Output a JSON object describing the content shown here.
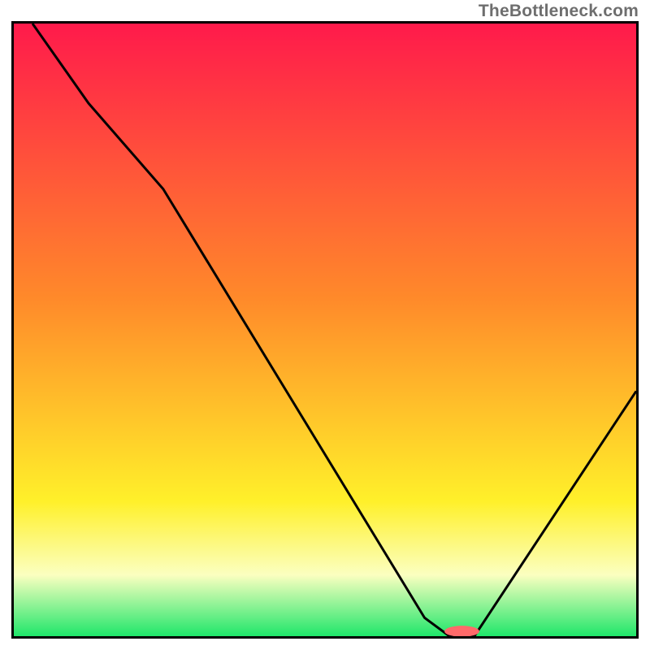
{
  "attribution": "TheBottleneck.com",
  "colors": {
    "red": "#ff1a4b",
    "orange": "#ff8a2a",
    "yellow": "#fff02a",
    "pale": "#fbffc0",
    "green": "#1fe66a",
    "marker": "#ff6a6a",
    "line": "#000000",
    "border": "#000000"
  },
  "chart_data": {
    "type": "line",
    "title": "",
    "xlabel": "",
    "ylabel": "",
    "xlim": [
      0,
      100
    ],
    "ylim": [
      0,
      100
    ],
    "gradient_stops": [
      {
        "pct": 0,
        "color_key": "red"
      },
      {
        "pct": 45,
        "color_key": "orange"
      },
      {
        "pct": 78,
        "color_key": "yellow"
      },
      {
        "pct": 90,
        "color_key": "pale"
      },
      {
        "pct": 100,
        "color_key": "green"
      }
    ],
    "x": [
      3,
      12,
      24,
      66,
      70,
      74,
      100
    ],
    "values": [
      100,
      87,
      73,
      3,
      0,
      0,
      40
    ],
    "marker": {
      "x": 72,
      "y": 0.8,
      "rx": 2.8,
      "ry": 0.9
    }
  }
}
